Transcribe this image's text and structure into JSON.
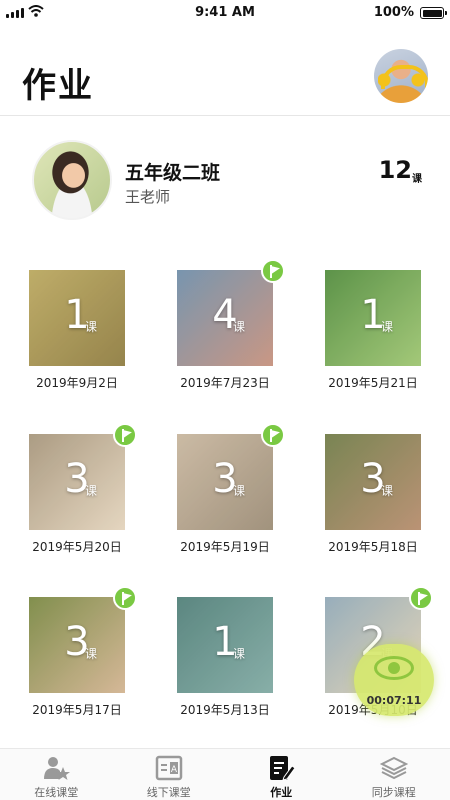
{
  "status_bar": {
    "time": "9:41 AM",
    "battery_percent": "100%"
  },
  "header": {
    "title": "作业"
  },
  "class_info": {
    "class_name": "五年级二班",
    "teacher": "王老师",
    "lesson_count": "12",
    "lesson_unit": "课"
  },
  "homework": [
    {
      "count": "1",
      "unit": "课",
      "date": "2019年9月2日",
      "flag": false,
      "colors": [
        "#b9a65c",
        "#8d7a3d"
      ]
    },
    {
      "count": "4",
      "unit": "课",
      "date": "2019年7月23日",
      "flag": true,
      "colors": [
        "#6d8da8",
        "#c58f7a"
      ]
    },
    {
      "count": "1",
      "unit": "课",
      "date": "2019年5月21日",
      "flag": false,
      "colors": [
        "#4f8a3a",
        "#9cc46e"
      ]
    },
    {
      "count": "3",
      "unit": "课",
      "date": "2019年5月20日",
      "flag": true,
      "colors": [
        "#a59479",
        "#e3d3bb"
      ]
    },
    {
      "count": "3",
      "unit": "课",
      "date": "2019年5月19日",
      "flag": true,
      "colors": [
        "#c7b59d",
        "#9a8a73"
      ]
    },
    {
      "count": "3",
      "unit": "课",
      "date": "2019年5月18日",
      "flag": false,
      "colors": [
        "#6e7a45",
        "#b58a6a"
      ]
    },
    {
      "count": "3",
      "unit": "课",
      "date": "2019年5月17日",
      "flag": true,
      "colors": [
        "#77863f",
        "#d2b28f"
      ]
    },
    {
      "count": "1",
      "unit": "课",
      "date": "2019年5月13日",
      "flag": false,
      "colors": [
        "#4e7d76",
        "#7ea8a1"
      ]
    },
    {
      "count": "2",
      "unit": "课",
      "date": "2019年5月10日",
      "flag": true,
      "colors": [
        "#8fa7b6",
        "#e2d2b1"
      ]
    }
  ],
  "timer": {
    "time": "00:07:11"
  },
  "tabs": [
    {
      "label": "在线课堂",
      "icon": "online-class-icon",
      "active": false
    },
    {
      "label": "线下课堂",
      "icon": "offline-class-icon",
      "active": false
    },
    {
      "label": "作业",
      "icon": "homework-icon",
      "active": true
    },
    {
      "label": "同步课程",
      "icon": "sync-course-icon",
      "active": false
    }
  ],
  "colors": {
    "accent_green": "#7ac943",
    "tab_icon": "#999999",
    "active_tab_icon": "#111111"
  }
}
